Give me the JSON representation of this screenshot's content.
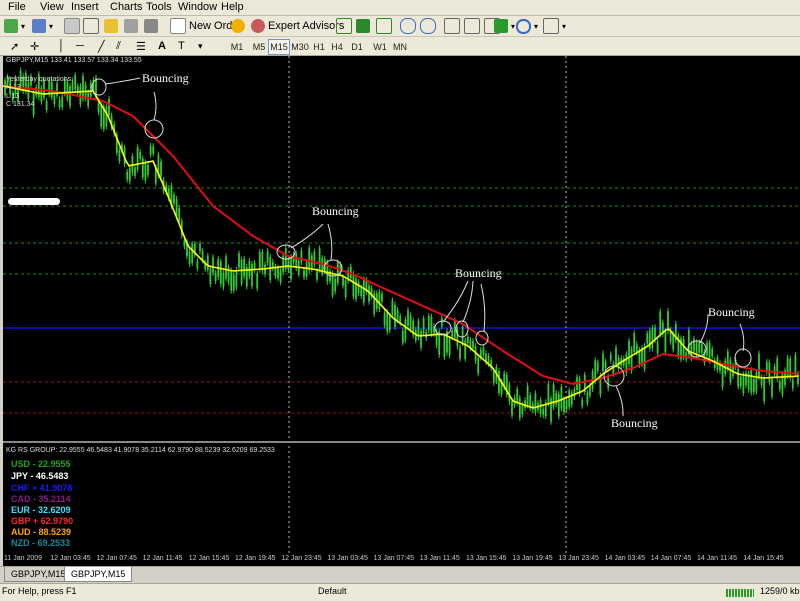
{
  "menu": [
    "File",
    "View",
    "Insert",
    "Charts",
    "Tools",
    "Window",
    "Help"
  ],
  "toolbar": {
    "new_order": "New Order",
    "expert_advisors": "Expert Advisors"
  },
  "timeframes": [
    "M1",
    "M5",
    "M15",
    "M30",
    "H1",
    "H4",
    "D1",
    "W1",
    "MN"
  ],
  "active_timeframe": "M15",
  "chart": {
    "symbol_line": "GBPJPY,M15 133.41 133.57 133.34 133.55",
    "yesterday_label": "Yesterday quotations:",
    "yest_h": "H 13",
    "yest_l": "L 13",
    "yest_c": "C 131.34",
    "annotation_text": "Bouncing",
    "subwindow_title": "KG RS GROUP: 22.9555 46.5483 41.9078 35.2114 62.9790 88.5239 32.6209 69.2533",
    "currencies": [
      {
        "label": "USD - 22.9555",
        "color": "#1fa51f"
      },
      {
        "label": "JPY - 46.5483",
        "color": "#ffffff"
      },
      {
        "label": "CHF + 41.9078",
        "color": "#1a1aff"
      },
      {
        "label": "CAD - 35.2114",
        "color": "#8b1a8b"
      },
      {
        "label": "EUR - 32.6209",
        "color": "#40e0ff"
      },
      {
        "label": "GBP + 62.9790",
        "color": "#ff2a2a"
      },
      {
        "label": "AUD - 88.5239",
        "color": "#ffa500"
      },
      {
        "label": "NZD - 69.2533",
        "color": "#1a8a9a"
      }
    ],
    "x_axis": [
      "11 Jan 2009",
      "12 Jan 03:45",
      "12 Jan 07:45",
      "12 Jan 11:45",
      "12 Jan 15:45",
      "12 Jan 19:45",
      "12 Jan 23:45",
      "13 Jan 03:45",
      "13 Jan 07:45",
      "13 Jan 11:45",
      "13 Jan 15:45",
      "13 Jan 19:45",
      "13 Jan 23:45",
      "14 Jan 03:45",
      "14 Jan 07:45",
      "14 Jan 11:45",
      "14 Jan 15:45"
    ],
    "colors": {
      "candles": "#32cd32",
      "ma_fast": "#ffff00",
      "ma_slow": "#e01010",
      "blue_line": "#1515ff",
      "green_dash": "#1a8a1a",
      "red_dash": "#a01414"
    }
  },
  "tabs": [
    "GBPJPY,M15",
    "GBPJPY,M15"
  ],
  "status": {
    "help": "For Help, press F1",
    "profile": "Default",
    "traffic": "1259/0 kb"
  }
}
